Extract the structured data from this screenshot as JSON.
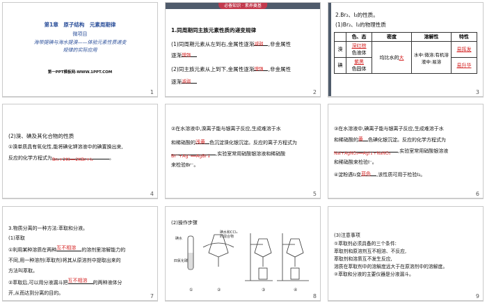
{
  "slides": [
    {
      "number": "1",
      "chapter": "第1章　原子结构　元素周期律",
      "subtitle": "微项目",
      "title_line1": "海带提碘与海水提溴——体验元素性质递变",
      "title_line2": "规律的实际应用",
      "footer": "第一PPT模板网-WWW.1PPT.COM"
    },
    {
      "number": "2",
      "tag": "必备知识 · 素养奠基",
      "heading": "1.同周期同主族元素性质的递变规律",
      "line1a": "(1)同周期元素从左到右,金属性逐渐",
      "answer1": "减弱",
      "line1b": ",非金属性",
      "line2a": "逐渐",
      "answer2": "增强",
      "line3a": "(2)同主族元素从上到下,金属性逐渐",
      "answer3": "增强",
      "line3b": ",非金属性",
      "line4a": "逐渐",
      "answer4": "减弱"
    },
    {
      "number": "3",
      "heading": "2.Br₂、I₂的性质。",
      "sub": "(1)Br₂、I₂的物理性质",
      "table_headers": [
        "",
        "色、态",
        "密度",
        "溶解性",
        "特性"
      ],
      "row_br_name": "溴",
      "row_br_color_answer": "深红棕",
      "row_br_state": "色液体",
      "density": "均比水的",
      "density_answer": "大",
      "solubility": "水中:微溶;有机溶液中:易溶",
      "row_br_special": "易挥发",
      "row_i_name": "碘",
      "row_i_color_answer": "紫黑",
      "row_i_state": "色固体",
      "row_i_special": "易升华"
    },
    {
      "number": "4",
      "heading": "(2)溴、碘及其化合物的性质",
      "line1": "①溴单质具有氧化性,能将碘化钾溶液中的碘置换出来,",
      "line2a": "反应的化学方程式为",
      "equation": "Br₂+2KI══2KBr+I₂",
      "line2b": "。"
    },
    {
      "number": "5",
      "line1": "②在水溶液中,溴离子能与银离子反应,生成难溶于水",
      "line2a": "和稀硝酸的",
      "answer": "浅黄",
      "line2b": "色沉淀溴化银沉淀。反应的离子方程式为",
      "equation": "Br⁻+Ag⁺══AgBr↓",
      "line3b": ",实验室常用硝酸银溶液和稀硝酸",
      "line4": "来检验Br⁻。"
    },
    {
      "number": "6",
      "line1": "③在水溶液中,碘离子能与银离子反应,生成难溶于水",
      "line2a": "和稀硝酸的",
      "answer": "黄",
      "line2b": "色碘化银沉淀。反应的化学方程式为",
      "equation": "NaI+AgNO₃══AgI↓+NaNO₃",
      "line3b": ",实验室常用硝酸银溶液",
      "line4": "和稀硝酸来检验I⁻。",
      "line5a": "④淀粉遇I₂变",
      "answer2": "蓝色",
      "line5b": ",该性质可用于检验I₂。"
    },
    {
      "number": "7",
      "heading": "3.物质分离的一种方法:萃取和分液。",
      "sub": "(1)萃取",
      "line1a": "①利用某种溶质在两种",
      "answer1": "互不相溶",
      "line1b": "的溶剂里溶解能力的",
      "line2": "不同,用一种溶剂(萃取剂)将其从原溶剂中提取出来的",
      "line3": "方法叫萃取。",
      "line4a": "②萃取后,可以用分液漏斗把",
      "answer2": "互不相溶",
      "line4b": "的两种液体分",
      "line5": "开,从而达到分离的目的。"
    },
    {
      "number": "8",
      "heading": "(2)操作步骤",
      "label1": "碘水和CCl₄的混合物",
      "label2": "碘水",
      "label3": "四氯化碳",
      "steps": [
        "①",
        "②",
        "③",
        "④"
      ]
    },
    {
      "number": "9",
      "heading": "(3)注意事项",
      "line1": "①萃取剂必须具备的三个条件:",
      "line2": "萃取剂和原溶剂互不相溶、不反应,",
      "line3": "萃取剂和溶质互不发生反应,",
      "line4": "溶质在萃取剂中的溶解度远大于在原溶剂中的溶解度。",
      "line5": "②萃取和分液的主要仪器是分液漏斗。"
    }
  ]
}
